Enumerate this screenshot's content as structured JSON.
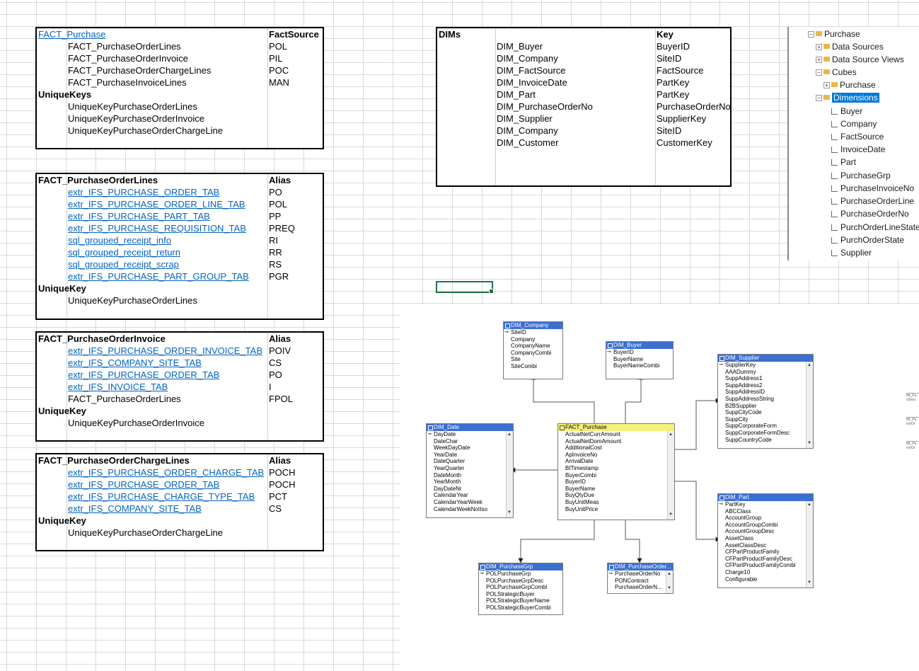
{
  "t1": {
    "h1": "FACT_Purchase",
    "h2": "FactSource",
    "rows": [
      {
        "name": "FACT_PurchaseOrderLines",
        "val": "POL"
      },
      {
        "name": "FACT_PurchaseOrderInvoice",
        "val": "PIL"
      },
      {
        "name": "FACT_PurchaseOrderChargeLines",
        "val": "POC"
      },
      {
        "name": "FACT_PurchaseInvoiceLines",
        "val": "MAN"
      }
    ],
    "uk_label": "UniqueKeys",
    "uks": [
      "UniqueKeyPurchaseOrderLines",
      "UniqueKeyPurchaseOrderInvoice",
      "UniqueKeyPurchaseOrderChargeLine"
    ]
  },
  "t2": {
    "h1": "FACT_PurchaseOrderLines",
    "h2": "Alias",
    "rows": [
      {
        "name": "extr_IFS_PURCHASE_ORDER_TAB",
        "val": "PO"
      },
      {
        "name": "extr_IFS_PURCHASE_ORDER_LINE_TAB",
        "val": "POL"
      },
      {
        "name": "extr_IFS_PURCHASE_PART_TAB",
        "val": "PP"
      },
      {
        "name": "extr_IFS_PURCHASE_REQUISITION_TAB",
        "val": "PREQ"
      },
      {
        "name": "sql_grouped_receipt_info",
        "val": "RI"
      },
      {
        "name": "sql_grouped_receipt_return",
        "val": "RR"
      },
      {
        "name": "sql_grouped_receipt_scrap",
        "val": "RS"
      },
      {
        "name": "extr_IFS_PURCHASE_PART_GROUP_TAB",
        "val": "PGR"
      }
    ],
    "uk_label": "UniqueKey",
    "uk": "UniqueKeyPurchaseOrderLines"
  },
  "t3": {
    "h1": "FACT_PurchaseOrderInvoice",
    "h2": "Alias",
    "rows": [
      {
        "name": "extr_IFS_PURCHASE_ORDER_INVOICE_TAB",
        "val": "POIV",
        "link": true
      },
      {
        "name": "extr_IFS_COMPANY_SITE_TAB",
        "val": "CS",
        "link": true
      },
      {
        "name": "extr_IFS_PURCHASE_ORDER_TAB",
        "val": "PO",
        "link": true
      },
      {
        "name": "extr_IFS_INVOICE_TAB",
        "val": "I",
        "link": true
      },
      {
        "name": "FACT_PurchaseOrderLines",
        "val": "FPOL",
        "link": false
      }
    ],
    "uk_label": "UniqueKey",
    "uk": "UniqueKeyPurchaseOrderInvoice"
  },
  "t4": {
    "h1": "FACT_PurchaseOrderChargeLines",
    "h2": "Alias",
    "rows": [
      {
        "name": "extr_IFS_PURCHASE_ORDER_CHARGE_TAB",
        "val": "POCH"
      },
      {
        "name": "extr_IFS_PURCHASE_ORDER_TAB",
        "val": "POCH"
      },
      {
        "name": "extr_IFS_PURCHASE_CHARGE_TYPE_TAB",
        "val": "PCT"
      },
      {
        "name": "extr_IFS_COMPANY_SITE_TAB",
        "val": "CS"
      }
    ],
    "uk_label": "UniqueKey",
    "uk": "UniqueKeyPurchaseOrderChargeLine"
  },
  "dims": {
    "h1": "DIMs",
    "h2": "Key",
    "rows": [
      {
        "name": "DIM_Buyer",
        "val": "BuyerID"
      },
      {
        "name": "DIM_Company",
        "val": "SiteID"
      },
      {
        "name": "DIM_FactSource",
        "val": "FactSource"
      },
      {
        "name": "DIM_InvoiceDate",
        "val": "PartKey"
      },
      {
        "name": "DIM_Part",
        "val": "PartKey"
      },
      {
        "name": "DIM_PurchaseOrderNo",
        "val": "PurchaseOrderNo"
      },
      {
        "name": "DIM_Supplier",
        "val": "SupplierKey"
      },
      {
        "name": "DIM_Company",
        "val": "SiteID"
      },
      {
        "name": "DIM_Customer",
        "val": "CustomerKey"
      }
    ]
  },
  "tree": {
    "root": "Purchase",
    "data_sources": "Data Sources",
    "dsv": "Data Source Views",
    "cubes": "Cubes",
    "cube_purchase": "Purchase",
    "dimensions": "Dimensions",
    "dims": [
      "Buyer",
      "Company",
      "FactSource",
      "InvoiceDate",
      "Part",
      "PurchaseGrp",
      "PurchaseInvoiceNo",
      "PurchaseOrderLine",
      "PurchaseOrderNo",
      "PurchOrderLineState",
      "PurchOrderState",
      "Supplier"
    ]
  },
  "diagram": {
    "company": {
      "title": "DIM_Company",
      "fields": [
        "SiteID",
        "Company",
        "CompanyName",
        "CompanyCombi",
        "Site",
        "SiteCombi"
      ]
    },
    "buyer": {
      "title": "DIM_Buyer",
      "fields": [
        "BuyerID",
        "BuyerName",
        "BuyerNameCombi"
      ]
    },
    "supplier": {
      "title": "DIM_Supplier",
      "fields": [
        "SupplierKey",
        "AAADummy",
        "SuppAddress1",
        "SuppAddress2",
        "SuppAddressID",
        "SuppAddressString",
        "B2BSupplier",
        "SuppCityCode",
        "SuppCity",
        "SuppCorporateForm",
        "SuppCorporateFormDesc",
        "SuppCountryCode"
      ]
    },
    "date": {
      "title": "DIM_Date",
      "fields": [
        "DayDate",
        "DateChar",
        "WeekDayDate",
        "YearDate",
        "DateQuarter",
        "YearQuarter",
        "DateMonth",
        "YearMonth",
        "DayDateNr",
        "CalendarYear",
        "CalendarYearWeek",
        "CalendarWeekNotIso"
      ]
    },
    "fact": {
      "title": "FACT_Purchase",
      "fields": [
        "ActualNetCurrAmount",
        "ActualNetDomAmount",
        "AdditionalCost",
        "ApInvoiceNo",
        "ArrivalDate",
        "BITimestamp",
        "BuyerCombi",
        "BuyerID",
        "BuyerName",
        "BuyQtyDue",
        "BuyUnitMeas",
        "BuyUnitPrice"
      ]
    },
    "part": {
      "title": "DIM_Part",
      "fields": [
        "PartKey",
        "ABCClass",
        "AccountGroup",
        "AccountGroupCombi",
        "AccountGroupDesc",
        "AssetClass",
        "AssetClassDesc",
        "CFPartProductFamily",
        "CFPartProductFamilyDesc",
        "CFPartProductFamilyCombi",
        "Charge10",
        "Configurable"
      ]
    },
    "pgrp": {
      "title": "DIM_PurchaseGrp",
      "fields": [
        "POLPurchaseGrp",
        "POLPurchaseGrpDesc",
        "POLPurchaseGrpCombi",
        "POLStrategicBuyer",
        "POLStrategicBuyerName",
        "POLStrategicBuyerCombi"
      ]
    },
    "pono": {
      "title": "DIM_PurchaseOrder...",
      "fields": [
        "PurchaseOrderNo",
        "PONContract",
        "PurchaseOrderN..."
      ]
    },
    "mini": [
      "IM_Fa\nctSou",
      "IM_Pu\nrchOr",
      "IM_Pu\nrchOr"
    ]
  }
}
